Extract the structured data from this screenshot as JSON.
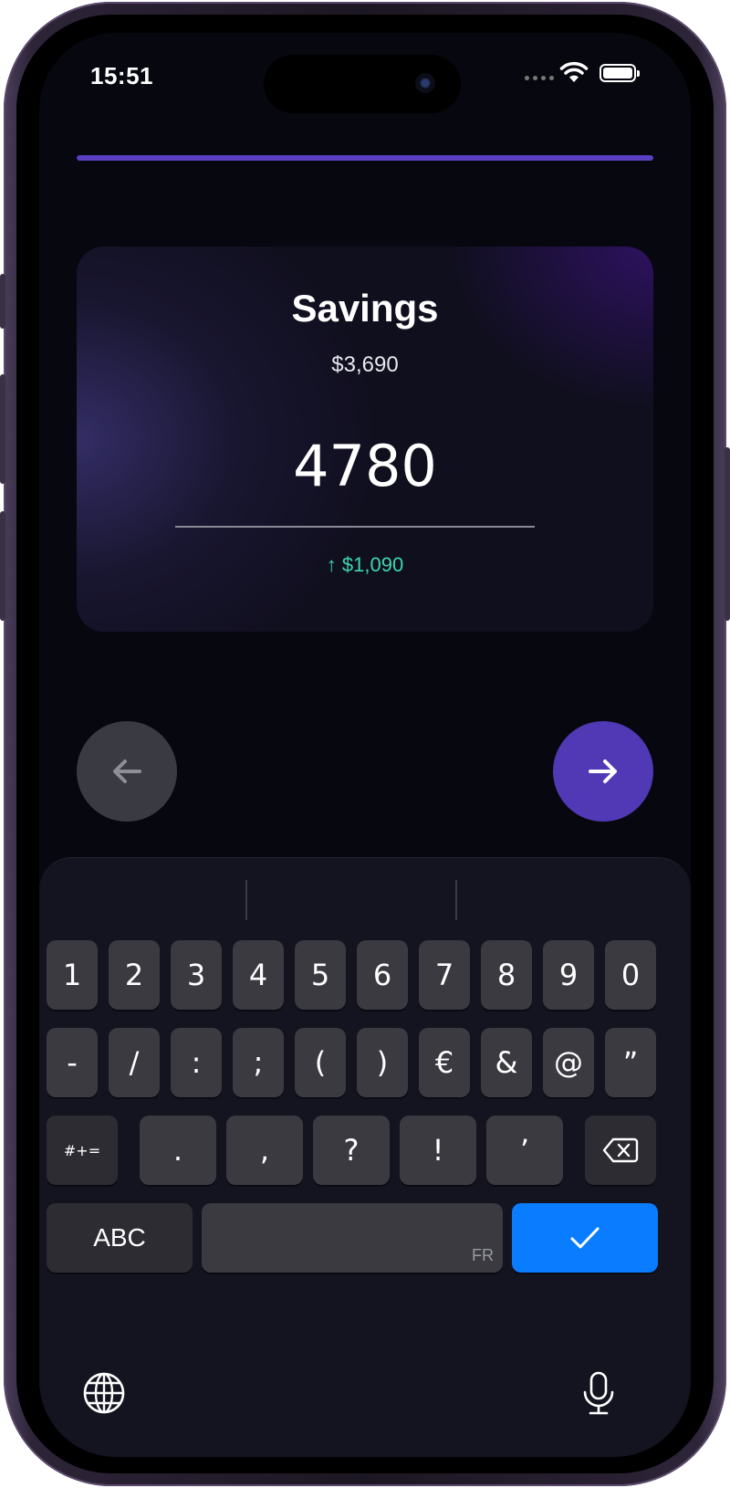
{
  "status_bar": {
    "time": "15:51"
  },
  "progress": {
    "fraction": 1.0,
    "color": "#5a3fc0"
  },
  "card": {
    "title": "Savings",
    "balance": "$3,690",
    "amount_value": "4780",
    "delta": "↑ $1,090",
    "delta_color": "#3dd6b0"
  },
  "nav": {
    "back_icon": "arrow-left-icon",
    "next_icon": "arrow-right-icon",
    "next_color": "#5138b5"
  },
  "keyboard": {
    "row1": [
      "1",
      "2",
      "3",
      "4",
      "5",
      "6",
      "7",
      "8",
      "9",
      "0"
    ],
    "row2": [
      "-",
      "/",
      ":",
      ";",
      "(",
      ")",
      "€",
      "&",
      "@",
      "”"
    ],
    "row3": {
      "shift_label": "#+=",
      "keys": [
        ".",
        ",",
        "?",
        "!",
        "’"
      ],
      "delete_icon": "backspace-icon"
    },
    "row4": {
      "abc_label": "ABC",
      "space_lang": "FR",
      "done_icon": "checkmark-icon",
      "done_color": "#0a7cff"
    },
    "bottom": {
      "globe_icon": "globe-icon",
      "mic_icon": "microphone-icon"
    }
  }
}
